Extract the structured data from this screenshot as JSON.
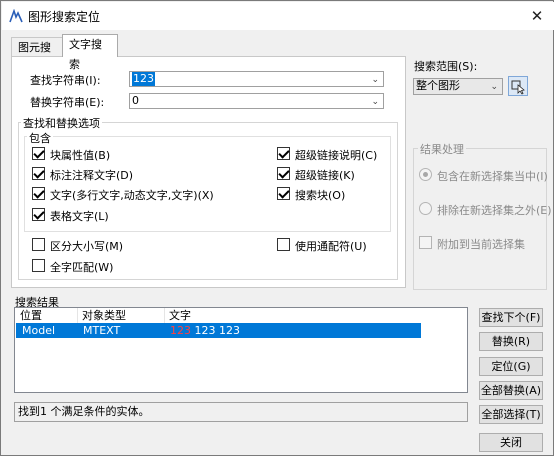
{
  "window": {
    "title": "图形搜索定位",
    "close": "✕"
  },
  "tabs": [
    {
      "label": "图元搜索"
    },
    {
      "label": "文字搜索"
    }
  ],
  "find": {
    "label": "查找字符串(I):",
    "value": "123"
  },
  "replace": {
    "label": "替换字符串(E):",
    "value": "0"
  },
  "options_group": {
    "title": "查找和替换选项",
    "include_title": "包含"
  },
  "checkboxes": [
    {
      "label": "块属性值(B)",
      "checked": true
    },
    {
      "label": "标注注释文字(D)",
      "checked": true
    },
    {
      "label": "文字(多行文字,动态文字,文字)(X)",
      "checked": true
    },
    {
      "label": "表格文字(L)",
      "checked": true
    },
    {
      "label": "超级链接说明(C)",
      "checked": true
    },
    {
      "label": "超级链接(K)",
      "checked": true
    },
    {
      "label": "搜索块(O)",
      "checked": true
    },
    {
      "label": "区分大小写(M)",
      "checked": false
    },
    {
      "label": "全字匹配(W)",
      "checked": false
    },
    {
      "label": "使用通配符(U)",
      "checked": false
    }
  ],
  "search_scope": {
    "label": "搜索范围(S):",
    "value": "整个图形"
  },
  "result_processing": {
    "title": "结果处理",
    "radio1": "包含在新选择集当中(I)",
    "radio2": "排除在新选择集之外(E)",
    "checkbox": "附加到当前选择集"
  },
  "results": {
    "label": "搜索结果",
    "columns": [
      "位置",
      "对象类型",
      "文字"
    ],
    "rows": [
      {
        "position": "Model",
        "type": "MTEXT",
        "text_match": "123",
        "text_rest": " 123 123"
      }
    ]
  },
  "status": "找到1 个满足条件的实体。",
  "buttons": {
    "find_next": "查找下个(F)",
    "replace": "替换(R)",
    "locate": "定位(G)",
    "replace_all": "全部替换(A)",
    "select_all": "全部选择(T)",
    "close": "关闭"
  }
}
